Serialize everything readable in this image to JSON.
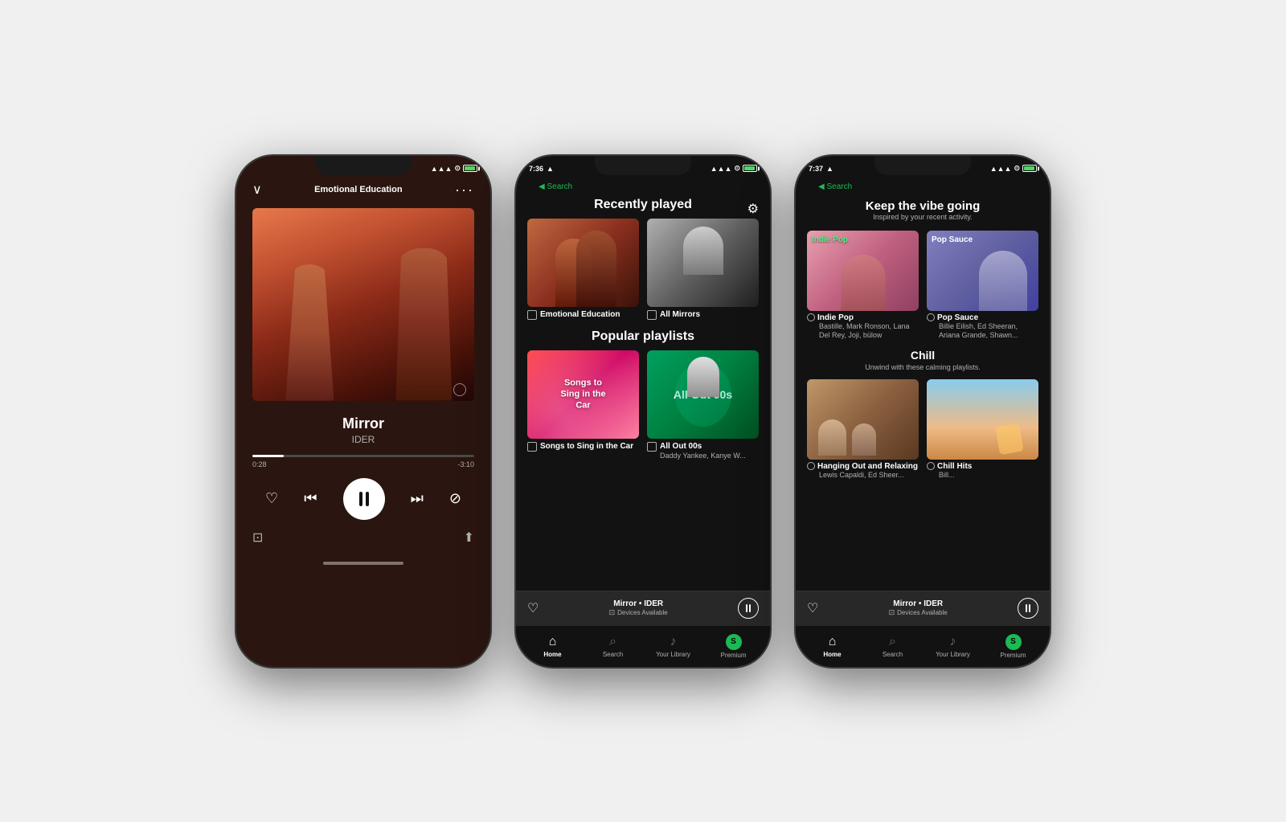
{
  "background_color": "#f0f0f0",
  "phone1": {
    "status": {
      "time": "",
      "signal": "●●●",
      "wifi": "wifi",
      "battery": "green"
    },
    "header": {
      "back_label": "∨",
      "title": "Emotional Education",
      "menu": "···"
    },
    "track": {
      "title": "Mirror",
      "artist": "IDER"
    },
    "progress": {
      "current": "0:28",
      "remaining": "-3:10",
      "percent": 14
    },
    "controls": {
      "heart": "♡",
      "skip_back": "⏮",
      "pause": "⏸",
      "skip_fwd": "⏭",
      "ban": "🚫"
    },
    "extra": {
      "devices": "⊡",
      "share": "⬆"
    }
  },
  "phone2": {
    "status": {
      "time": "7:36",
      "location": "▲",
      "signal": "●●●",
      "wifi": "wifi",
      "battery": "green"
    },
    "back_search": "◀ Search",
    "gear": "⚙",
    "recently_played": {
      "title": "Recently played",
      "items": [
        {
          "name": "Emotional Education",
          "type": "playlist"
        },
        {
          "name": "All Mirrors",
          "type": "playlist"
        }
      ]
    },
    "popular_playlists": {
      "title": "Popular playlists",
      "items": [
        {
          "name": "Songs to Sing in the Car",
          "sub": ""
        },
        {
          "name": "All Out 00s",
          "sub": "Daddy Yankee, Kanye W..."
        }
      ]
    },
    "mini_player": {
      "track": "Mirror • IDER",
      "devices": "Devices Available"
    },
    "nav": {
      "home": "Home",
      "search": "Search",
      "library": "Your Library",
      "premium": "Premium"
    }
  },
  "phone3": {
    "status": {
      "time": "7:37",
      "location": "▲",
      "signal": "●●●",
      "wifi": "wifi",
      "battery": "green"
    },
    "back_search": "◀ Search",
    "header": {
      "title": "Keep the vibe going",
      "subtitle": "Inspired by your recent activity."
    },
    "vibe_section": {
      "items": [
        {
          "name": "Indie Pop",
          "sub": "Bastille, Mark Ronson, Lana Del Rey, Joji, bülow",
          "genre_label": "Indie Pop"
        },
        {
          "name": "Pop Sauce",
          "sub": "Billie Eilish, Ed Sheeran, Ariana Grande, Shawn...",
          "genre_label": "Pop Sauce"
        }
      ]
    },
    "chill_section": {
      "title": "Chill",
      "subtitle": "Unwind with these calming playlists.",
      "items": [
        {
          "name": "Hanging Out and Relaxing",
          "sub": "Lewis Capaldi, Ed Sheer..."
        },
        {
          "name": "Chill Hits",
          "sub": "Bill..."
        }
      ]
    },
    "mini_player": {
      "track": "Mirror • IDER",
      "devices": "Devices Available"
    },
    "nav": {
      "home": "Home",
      "search": "Search",
      "library": "Your Library",
      "premium": "Premium"
    }
  }
}
